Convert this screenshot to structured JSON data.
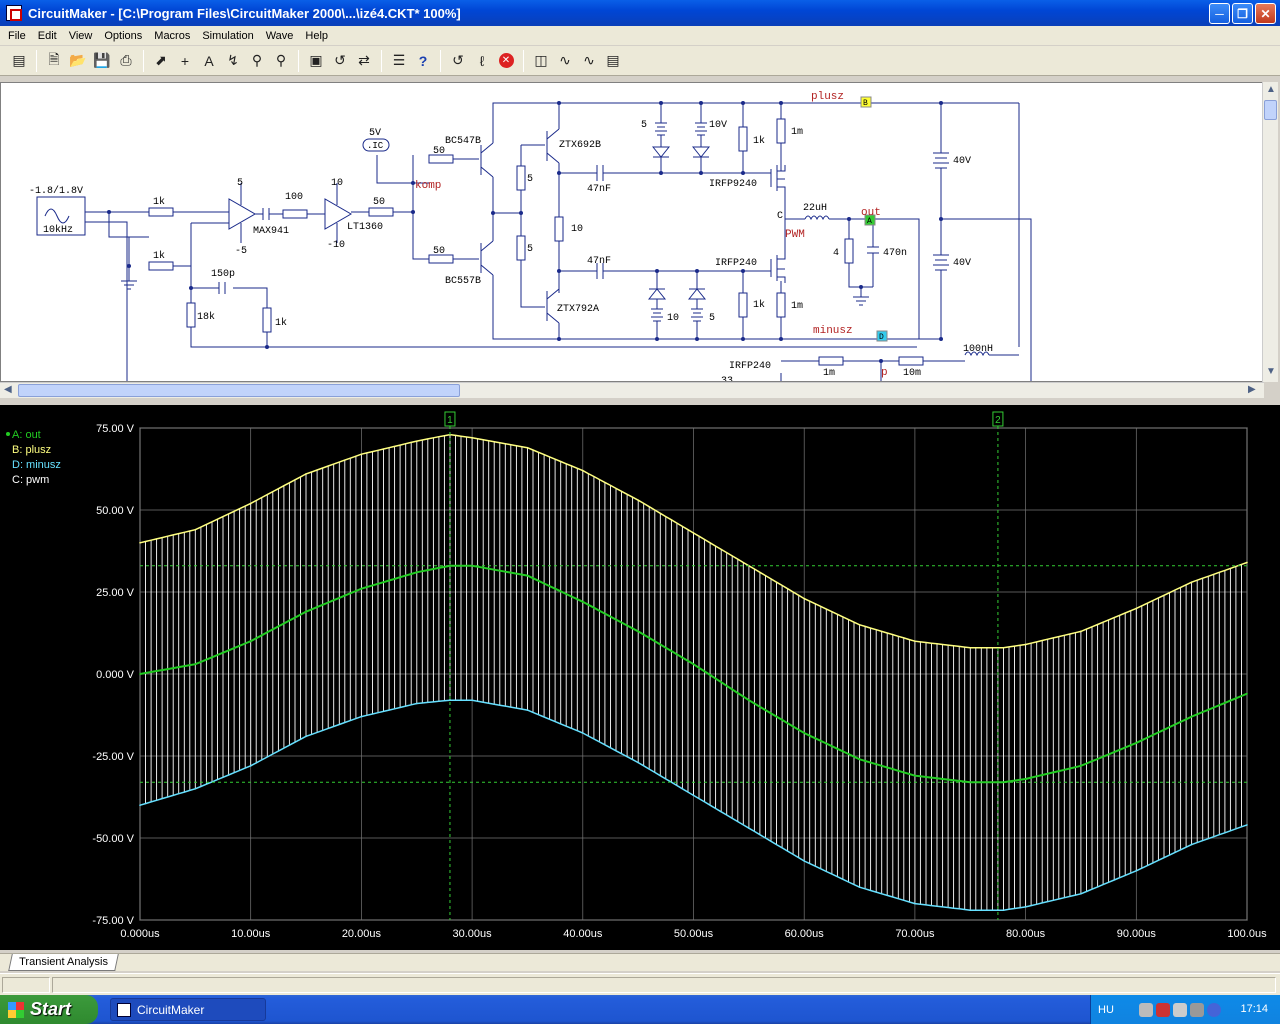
{
  "window": {
    "title": "CircuitMaker - [C:\\Program Files\\CircuitMaker 2000\\...\\izé4.CKT* 100%]"
  },
  "menu": [
    "File",
    "Edit",
    "View",
    "Options",
    "Macros",
    "Simulation",
    "Wave",
    "Help"
  ],
  "toolbar_icons": [
    "new-icon",
    "open-icon",
    "save-icon",
    "print-icon",
    "pointer-icon",
    "wire-icon",
    "text-icon",
    "probe-icon",
    "zoom-icon"
  ],
  "schematic": {
    "source": {
      "amplitude": "-1.8/1.8V",
      "freq": "10kHz"
    },
    "labels": {
      "r1k_a": "1k",
      "r1k_b": "1k",
      "r18k": "18k",
      "r1k_c": "1k",
      "c150p": "150p",
      "opamp1": "MAX941",
      "op1_pos": "5",
      "op1_neg": "-5",
      "r100": "100",
      "opamp2": "LT1360",
      "op2_pos": "10",
      "op2_neg": "-10",
      "r50_a": "50",
      "r50_b": "50",
      "r50_c": "50",
      "ic_v": "5V",
      "ic": ".IC",
      "komp": "komp",
      "q1": "BC547B",
      "q2": "BC557B",
      "r5_a": "5",
      "r5_b": "5",
      "r10": "10",
      "q3": "ZTX692B",
      "q4": "ZTX792A",
      "c47_a": "47nF",
      "c47_b": "47nF",
      "z5_a": "5",
      "z10_a": "10V",
      "z10_b": "10",
      "z5_b": "5",
      "r1k_d": "1k",
      "r1k_e": "1k",
      "r1m_a": "1m",
      "r1m_b": "1m",
      "m1": "IRFP9240",
      "m2": "IRFP240",
      "pwm": "PWM",
      "c_node": "C",
      "l22": "22uH",
      "out": "out",
      "r4": "4",
      "c470": "470n",
      "plusz": "plusz",
      "minusz": "minusz",
      "b40a": "40V",
      "b40b": "40V",
      "m3": "IRFP240",
      "r33": "33",
      "r1m_c": "1m",
      "p": "p",
      "r10m": "10m",
      "l100": "100nH",
      "probe_a": "A",
      "probe_b": "B",
      "probe_d": "D"
    }
  },
  "scope": {
    "legend": [
      {
        "name": "A: out",
        "color": "#22cc22"
      },
      {
        "name": "B: plusz",
        "color": "#ffff80"
      },
      {
        "name": "D: minusz",
        "color": "#66e0ff"
      },
      {
        "name": "C: pwm",
        "color": "#ffffff"
      }
    ],
    "cursor1": "1",
    "cursor2": "2"
  },
  "chart_data": {
    "type": "line",
    "xlabel": "",
    "ylabel": "",
    "x_unit": "us",
    "xlim": [
      0,
      100
    ],
    "ylim": [
      -75,
      75
    ],
    "xticks": [
      "0.000us",
      "10.00us",
      "20.00us",
      "30.00us",
      "40.00us",
      "50.00us",
      "60.00us",
      "70.00us",
      "80.00us",
      "90.00us",
      "100.0us"
    ],
    "yticks": [
      "75.00 V",
      "50.00 V",
      "25.00 V",
      "0.000 V",
      "-25.00 V",
      "-50.00 V",
      "-75.00 V"
    ],
    "series": [
      {
        "name": "A: out",
        "x": [
          0,
          5,
          10,
          15,
          20,
          25,
          28,
          30,
          35,
          40,
          45,
          50,
          55,
          60,
          65,
          70,
          75,
          78,
          80,
          85,
          90,
          95,
          100
        ],
        "values": [
          0,
          3,
          10,
          19,
          26,
          31,
          33,
          33,
          30,
          22,
          13,
          3,
          -8,
          -18,
          -26,
          -31,
          -33,
          -33,
          -32,
          -28,
          -21,
          -13,
          -6
        ]
      },
      {
        "name": "B: plusz",
        "x": [
          0,
          5,
          10,
          15,
          20,
          25,
          28,
          30,
          35,
          40,
          45,
          50,
          55,
          60,
          65,
          70,
          75,
          78,
          80,
          85,
          90,
          95,
          100
        ],
        "values": [
          40,
          44,
          52,
          61,
          67,
          71,
          73,
          72,
          69,
          62,
          53,
          43,
          33,
          23,
          15,
          10,
          8,
          8,
          9,
          13,
          20,
          28,
          34
        ]
      },
      {
        "name": "D: minusz",
        "x": [
          0,
          5,
          10,
          15,
          20,
          25,
          28,
          30,
          35,
          40,
          45,
          50,
          55,
          60,
          65,
          70,
          75,
          78,
          80,
          85,
          90,
          95,
          100
        ],
        "values": [
          -40,
          -35,
          -28,
          -19,
          -13,
          -9,
          -8,
          -8,
          -11,
          -18,
          -27,
          -37,
          -47,
          -57,
          -65,
          -70,
          -72,
          -72,
          -71,
          -67,
          -60,
          -52,
          -46
        ]
      }
    ],
    "cursors_x": [
      28,
      77.5
    ],
    "cursor_levels": [
      33,
      -33
    ]
  },
  "tabs": {
    "active": "Transient Analysis"
  },
  "taskbar": {
    "start": "Start",
    "task": "CircuitMaker",
    "lang": "HU",
    "clock": "17:14"
  }
}
